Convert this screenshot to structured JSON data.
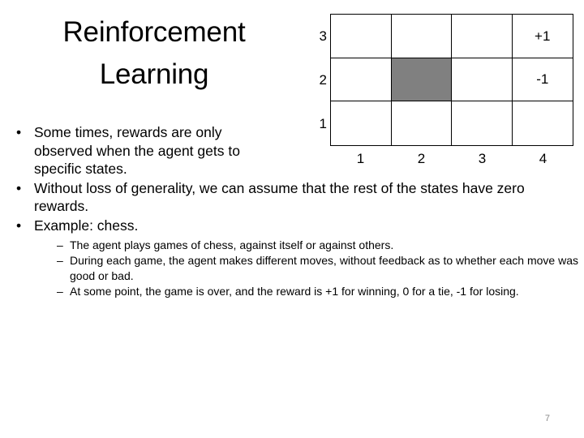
{
  "slide": {
    "title": "Reinforcement\nLearning",
    "page_number": "7"
  },
  "gridworld": {
    "row_labels": [
      "3",
      "2",
      "1"
    ],
    "col_labels": [
      "1",
      "2",
      "3",
      "4"
    ],
    "blocked_color": "#808080",
    "cells": [
      {
        "row": 3,
        "col": 1,
        "label": "",
        "state": "empty"
      },
      {
        "row": 3,
        "col": 2,
        "label": "",
        "state": "empty"
      },
      {
        "row": 3,
        "col": 3,
        "label": "",
        "state": "empty"
      },
      {
        "row": 3,
        "col": 4,
        "label": "+1",
        "state": "reward"
      },
      {
        "row": 2,
        "col": 1,
        "label": "",
        "state": "empty"
      },
      {
        "row": 2,
        "col": 2,
        "label": "",
        "state": "blocked"
      },
      {
        "row": 2,
        "col": 3,
        "label": "",
        "state": "empty"
      },
      {
        "row": 2,
        "col": 4,
        "label": "-1",
        "state": "reward"
      },
      {
        "row": 1,
        "col": 1,
        "label": "",
        "state": "empty"
      },
      {
        "row": 1,
        "col": 2,
        "label": "",
        "state": "empty"
      },
      {
        "row": 1,
        "col": 3,
        "label": "",
        "state": "empty"
      },
      {
        "row": 1,
        "col": 4,
        "label": "",
        "state": "empty"
      }
    ]
  },
  "body": {
    "bullet_marker": "•",
    "sub_bullet_marker": "–",
    "bullets": [
      "Some times, rewards are only observed when the agent gets to specific states.",
      "Without loss of generality, we can assume that the rest of the states have zero rewards.",
      "Example: chess."
    ],
    "sub_bullets": [
      "The agent plays games of chess, against itself or against others.",
      "During each game, the agent makes different moves, without feedback as to whether each move was good or bad.",
      "At some point, the game is over, and the reward is +1 for winning, 0 for a tie, -1 for losing."
    ]
  }
}
